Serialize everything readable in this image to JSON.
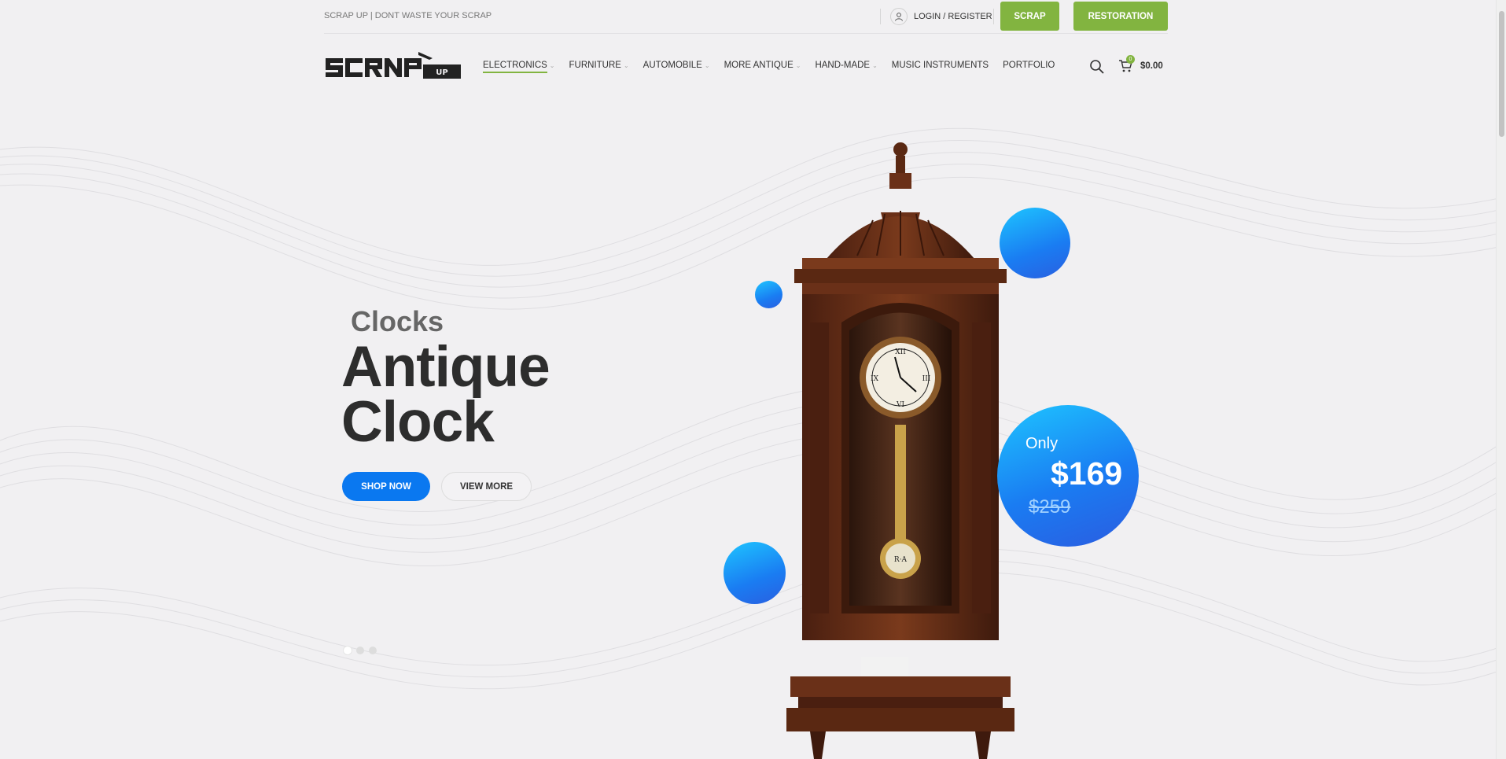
{
  "topbar": {
    "tagline": "SCRAP UP | DONT WASTE YOUR SCRAP",
    "login_label": "LOGIN / REGISTER",
    "scrap_label": "SCRAP",
    "restoration_label": "RESTORATION"
  },
  "header": {
    "logo_text": "SCRAP UP",
    "nav": [
      {
        "label": "ELECTRONICS",
        "has_dropdown": true,
        "active": true
      },
      {
        "label": "FURNITURE",
        "has_dropdown": true
      },
      {
        "label": "AUTOMOBILE",
        "has_dropdown": true
      },
      {
        "label": "MORE ANTIQUE",
        "has_dropdown": true
      },
      {
        "label": "HAND-MADE",
        "has_dropdown": true
      },
      {
        "label": "MUSIC INSTRUMENTS",
        "has_dropdown": false
      },
      {
        "label": "PORTFOLIO",
        "has_dropdown": false
      }
    ],
    "search_icon": "search-icon",
    "cart": {
      "count": "0",
      "total": "$0.00",
      "icon": "cart-icon"
    }
  },
  "hero": {
    "subtitle": "Clocks",
    "title_line1": "Antique",
    "title_line2": "Clock",
    "shop_now": "SHOP NOW",
    "view_more": "VIEW MORE",
    "price": {
      "only": "Only",
      "now": "$169",
      "was": "$259"
    },
    "slides": 3,
    "active_slide": 0
  },
  "colors": {
    "accent_green": "#82b440",
    "accent_blue": "#0a78f0",
    "bubble_blue": "#1a7cf2"
  }
}
